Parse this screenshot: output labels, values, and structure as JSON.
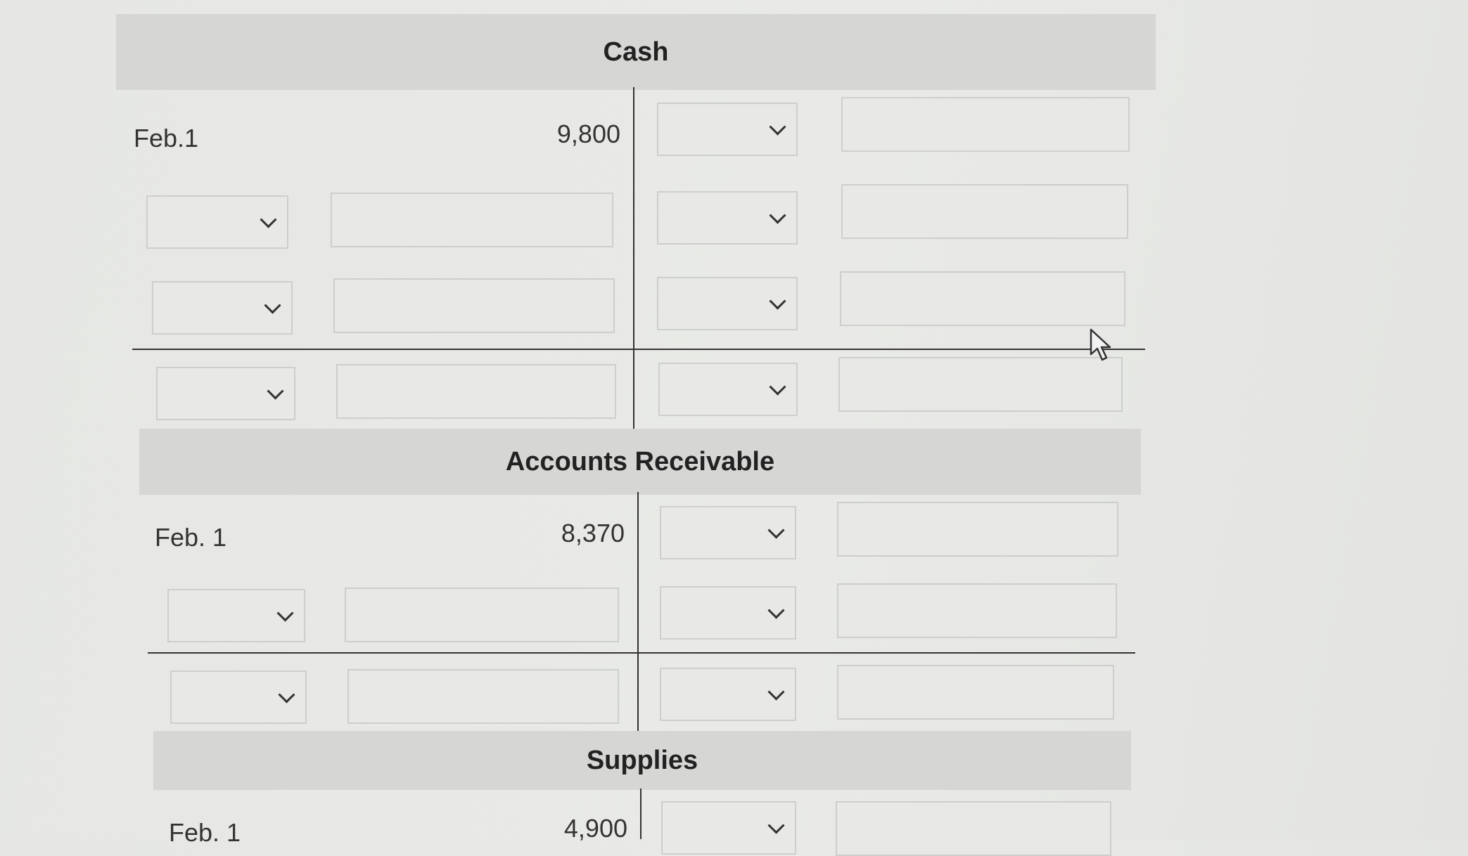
{
  "accounts": [
    {
      "title": "Cash",
      "entry_date": "Feb.1",
      "entry_amount": "9,800"
    },
    {
      "title": "Accounts Receivable",
      "entry_date": "Feb. 1",
      "entry_amount": "8,370"
    },
    {
      "title": "Supplies",
      "entry_date": "Feb. 1",
      "entry_amount": "4,900"
    }
  ],
  "icons": {
    "dropdown": "chevron-down-icon",
    "cursor": "mouse-pointer-icon"
  },
  "colors": {
    "header_bg": "#d6d7d4",
    "field_border": "#cdcfcb",
    "rule_line": "#333333"
  }
}
